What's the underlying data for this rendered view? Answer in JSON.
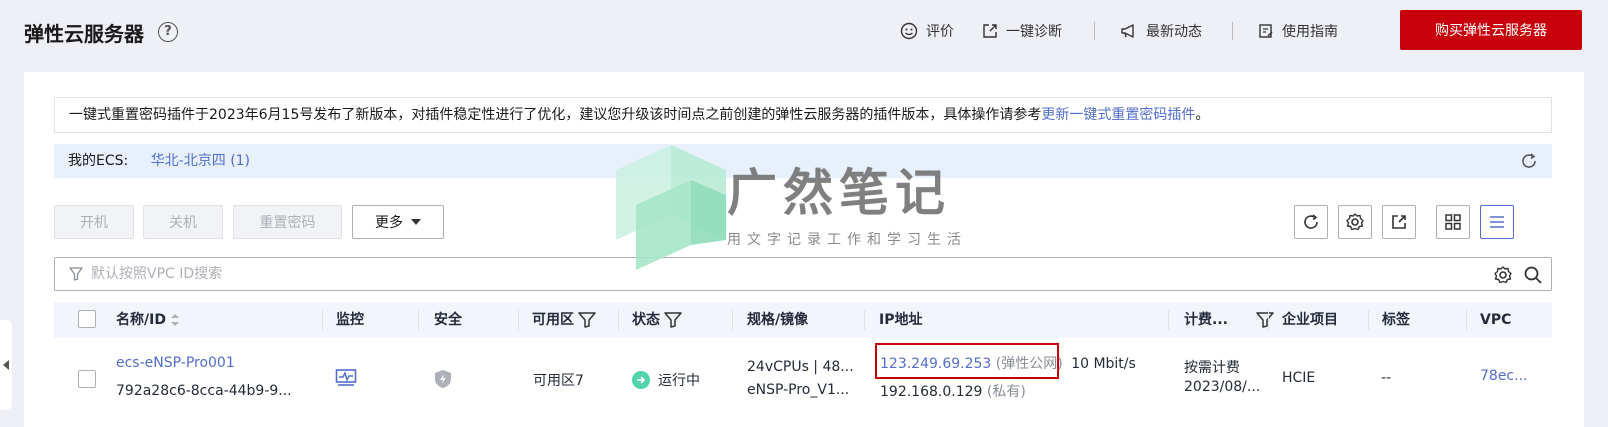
{
  "header": {
    "title": "弹性云服务器",
    "help": "?",
    "links": [
      {
        "label": "评价",
        "icon": "smile-icon"
      },
      {
        "label": "一键诊断",
        "icon": "diagnose-icon"
      },
      {
        "label": "最新动态",
        "icon": "megaphone-icon"
      },
      {
        "label": "使用指南",
        "icon": "guide-icon"
      }
    ],
    "buy_button": "购买弹性云服务器"
  },
  "notice": {
    "text": "一键式重置密码插件于2023年6月15号发布了新版本，对插件稳定性进行了优化，建议您升级该时间点之前创建的弹性云服务器的插件版本，具体操作请参考",
    "link": "更新一键式重置密码插件",
    "end": "。"
  },
  "my_ecs": {
    "label": "我的ECS:",
    "region": "华北-北京四 (1)"
  },
  "toolbar": {
    "start": "开机",
    "stop": "关机",
    "reset_password": "重置密码",
    "more": "更多"
  },
  "search": {
    "placeholder": "默认按照VPC ID搜索"
  },
  "table": {
    "headers": {
      "name": "名称/ID",
      "monitor": "监控",
      "security": "安全",
      "az": "可用区",
      "status": "状态",
      "spec": "规格/镜像",
      "ip": "IP地址",
      "billing": "计费...",
      "project": "企业项目",
      "tag": "标签",
      "vpc": "VPC"
    },
    "rows": [
      {
        "name": "ecs-eNSP-Pro001",
        "id": "792a28c6-8cca-44b9-9...",
        "az": "可用区7",
        "status": "运行中",
        "spec": "24vCPUs | 48...",
        "image": "eNSP-Pro_V1...",
        "public_ip": "123.249.69.253",
        "public_tag": "(弹性公网)",
        "bandwidth": "10 Mbit/s",
        "private_ip": "192.168.0.129",
        "private_tag": "(私有)",
        "billing": "按需计费",
        "billing_date": "2023/08/...",
        "project": "HCIE",
        "tag": "--",
        "vpc": "78ec..."
      }
    ]
  },
  "watermark": {
    "title": "广然笔记",
    "subtitle": "用文字记录工作和学习生活"
  },
  "colors": {
    "accent": "#c7000b",
    "link": "#526ecc",
    "running": "#50d4ab"
  }
}
